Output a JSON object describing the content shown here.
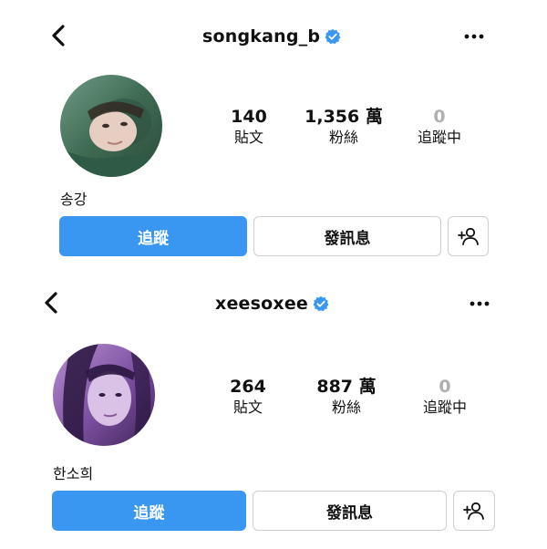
{
  "profiles": [
    {
      "username": "songkang_b",
      "display_name": "송강",
      "stats": [
        {
          "value": "140",
          "label": "貼文"
        },
        {
          "value": "1,356 萬",
          "label": "粉絲"
        },
        {
          "value": "0",
          "label": "追蹤中"
        }
      ],
      "follow_label": "追蹤",
      "message_label": "發訊息",
      "icons": {
        "back": "chevron-left-icon",
        "more": "more-horizontal-icon",
        "verified": "verified-badge-icon",
        "add_user": "add-user-icon"
      },
      "avatar_tint": "#3f6a52"
    },
    {
      "username": "xeesoxee",
      "display_name": "한소희",
      "stats": [
        {
          "value": "264",
          "label": "貼文"
        },
        {
          "value": "887 萬",
          "label": "粉絲"
        },
        {
          "value": "0",
          "label": "追蹤中"
        }
      ],
      "follow_label": "追蹤",
      "message_label": "發訊息",
      "icons": {
        "back": "chevron-left-icon",
        "more": "more-horizontal-icon",
        "verified": "verified-badge-icon",
        "add_user": "add-user-icon"
      },
      "avatar_tint": "#7b4fa0"
    }
  ],
  "colors": {
    "accent": "#3a97f1",
    "verified": "#3a97f1",
    "muted": "#b0b0b0"
  }
}
